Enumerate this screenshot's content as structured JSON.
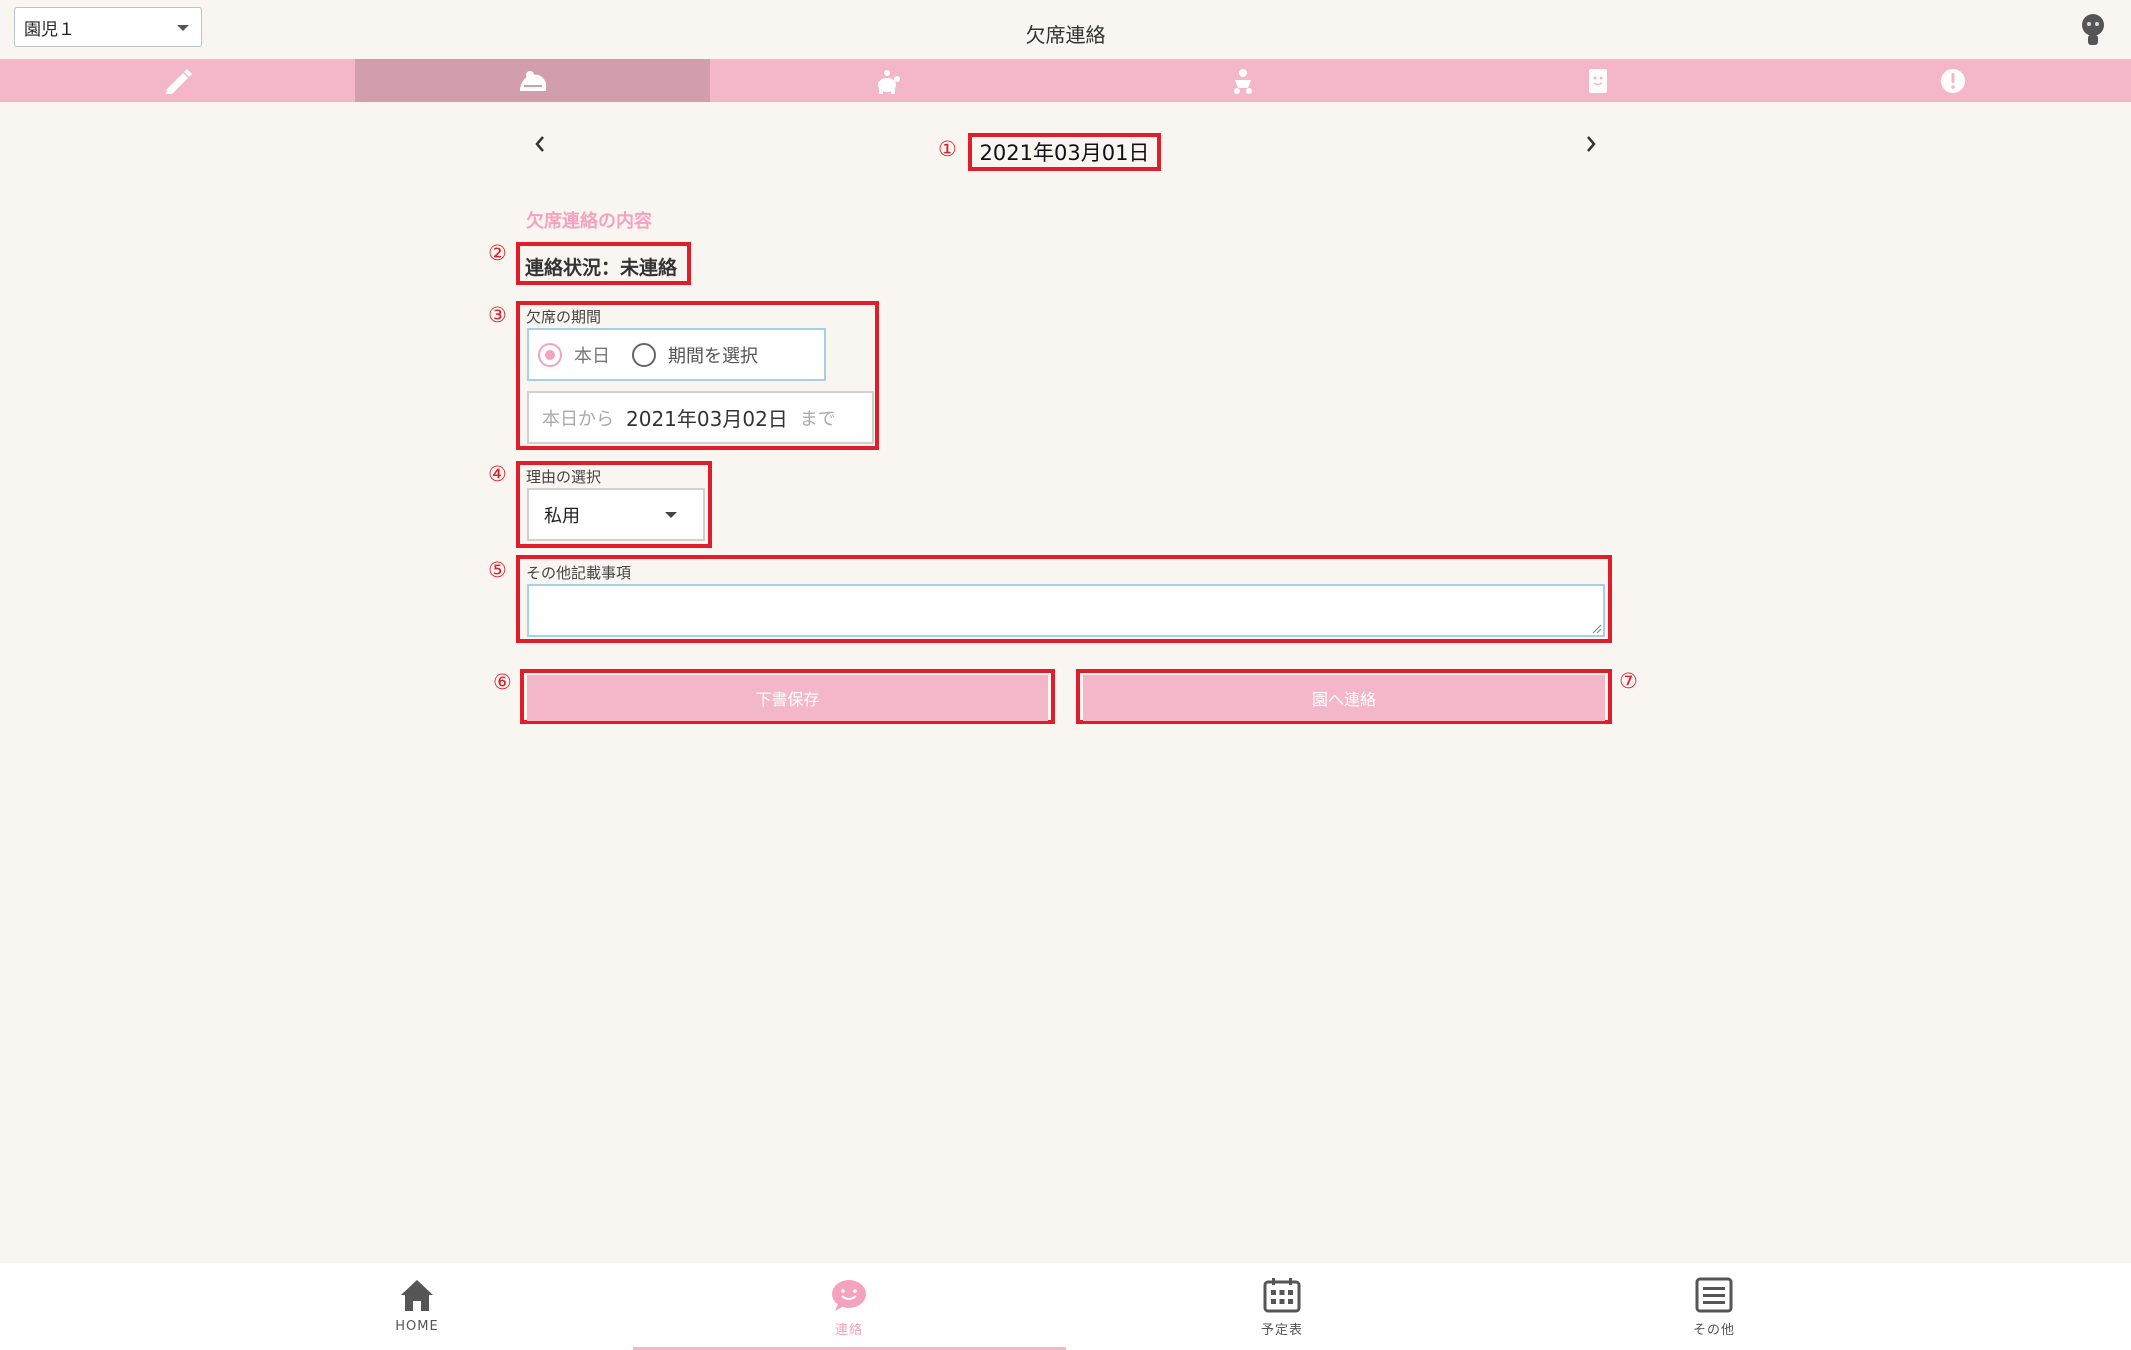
{
  "header": {
    "child_selector": "園児１",
    "title": "欠席連絡"
  },
  "tabs": [
    {
      "icon": "pencil-icon"
    },
    {
      "icon": "sick-bed-icon",
      "active": true
    },
    {
      "icon": "turtle-icon"
    },
    {
      "icon": "running-child-icon"
    },
    {
      "icon": "note-icon"
    },
    {
      "icon": "alert-icon"
    }
  ],
  "date_nav": {
    "current_date": "2021年03月01日"
  },
  "markers": [
    "①",
    "②",
    "③",
    "④",
    "⑤",
    "⑥",
    "⑦"
  ],
  "form": {
    "section_heading": "欠席連絡の内容",
    "status": "連絡状況：未連絡",
    "period_label": "欠席の期間",
    "period_options": [
      "本日",
      "期間を選択"
    ],
    "period_selected": "本日",
    "period_prefix": "本日から",
    "period_end_date": "2021年03月02日",
    "period_suffix": "まで",
    "reason_label": "理由の選択",
    "reason_value": "私用",
    "notes_label": "その他記載事項",
    "notes_value": "",
    "save_draft_button": "下書保存",
    "send_button": "園へ連絡"
  },
  "bottom_nav": [
    {
      "label": "HOME",
      "icon": "home-icon"
    },
    {
      "label": "連絡",
      "icon": "chat-smile-icon",
      "active": true
    },
    {
      "label": "予定表",
      "icon": "calendar-icon"
    },
    {
      "label": "その他",
      "icon": "menu-icon"
    }
  ],
  "colors": {
    "background": "#f9f6f1",
    "tab_bar": "#f4b7ca",
    "tab_active": "#d29eae",
    "accent_pink": "#f4a3bf",
    "annotation_red": "#e01e2b"
  }
}
